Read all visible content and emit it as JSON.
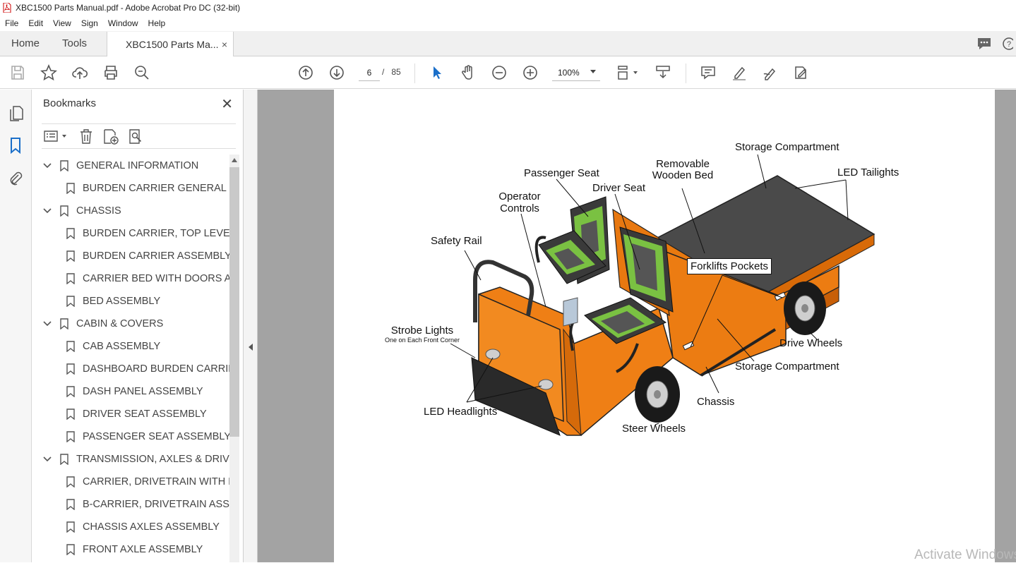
{
  "window": {
    "title": "XBC1500 Parts Manual.pdf - Adobe Acrobat Pro DC (32-bit)"
  },
  "menu": [
    "File",
    "Edit",
    "View",
    "Sign",
    "Window",
    "Help"
  ],
  "tabs": {
    "home": "Home",
    "tools": "Tools",
    "document": "XBC1500 Parts Ma...",
    "close": "×"
  },
  "toolbar": {
    "current_page": "6",
    "page_separator": "/",
    "total_pages": "85",
    "zoom": "100%"
  },
  "bookmarks": {
    "title": "Bookmarks",
    "close": "✕",
    "items": [
      {
        "label": "GENERAL INFORMATION",
        "level": 0
      },
      {
        "label": "BURDEN CARRIER GENERAL IN",
        "level": 1
      },
      {
        "label": "CHASSIS",
        "level": 0
      },
      {
        "label": "BURDEN CARRIER, TOP LEVEL A",
        "level": 1
      },
      {
        "label": "BURDEN CARRIER ASSEMBLY",
        "level": 1
      },
      {
        "label": "CARRIER BED WITH DOORS AS",
        "level": 1
      },
      {
        "label": "BED ASSEMBLY",
        "level": 1
      },
      {
        "label": "CABIN & COVERS",
        "level": 0
      },
      {
        "label": "CAB ASSEMBLY",
        "level": 1
      },
      {
        "label": "DASHBOARD BURDEN CARRIE",
        "level": 1
      },
      {
        "label": "DASH PANEL ASSEMBLY",
        "level": 1
      },
      {
        "label": "DRIVER SEAT ASSEMBLY",
        "level": 1
      },
      {
        "label": "PASSENGER SEAT ASSEMBLY",
        "level": 1
      },
      {
        "label": "TRANSMISSION, AXLES & DRIVES",
        "level": 0
      },
      {
        "label": "CARRIER, DRIVETRAIN WITH FR",
        "level": 1
      },
      {
        "label": "B-CARRIER, DRIVETRAIN ASSEM",
        "level": 1
      },
      {
        "label": "CHASSIS AXLES ASSEMBLY",
        "level": 1
      },
      {
        "label": "FRONT AXLE ASSEMBLY",
        "level": 1
      }
    ]
  },
  "diagram": {
    "storage_top": "Storage Compartment",
    "led_tail": "LED Tailights",
    "removable_1": "Removable",
    "removable_2": "Wooden Bed",
    "passenger_seat": "Passenger Seat",
    "driver_seat": "Driver Seat",
    "operator_1": "Operator",
    "operator_2": "Controls",
    "safety_rail": "Safety Rail",
    "forklift": "Forklifts Pockets",
    "strobe": "Strobe Lights",
    "strobe_sub": "One on Each Front Corner",
    "drive_wheels": "Drive Wheels",
    "storage_bottom": "Storage Compartment",
    "led_head": "LED Headlights",
    "chassis": "Chassis",
    "steer_wheels": "Steer Wheels"
  },
  "watermark": "Activate Windows",
  "colors": {
    "body_orange": "#e8790f",
    "seat_green": "#7ac142",
    "bed_gray": "#4a4a4a",
    "viewer_bg": "#a3a3a3"
  }
}
